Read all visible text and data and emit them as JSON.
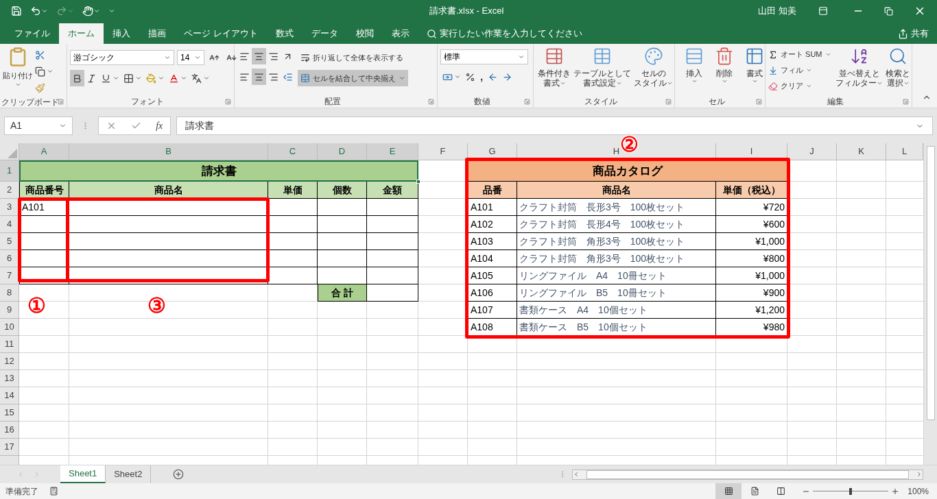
{
  "title_bar": {
    "title": "請求書.xlsx  -  Excel",
    "user": "山田 知美"
  },
  "ribbon_tabs": [
    {
      "label": "ファイル",
      "selected": false
    },
    {
      "label": "ホーム",
      "selected": true
    },
    {
      "label": "挿入",
      "selected": false
    },
    {
      "label": "描画",
      "selected": false
    },
    {
      "label": "ページ レイアウト",
      "selected": false
    },
    {
      "label": "数式",
      "selected": false
    },
    {
      "label": "データ",
      "selected": false
    },
    {
      "label": "校閲",
      "selected": false
    },
    {
      "label": "表示",
      "selected": false
    }
  ],
  "tell_me": "実行したい作業を入力してください",
  "share": "共有",
  "ribbon": {
    "clipboard": {
      "label": "クリップボード",
      "paste": "貼り付け"
    },
    "font": {
      "label": "フォント",
      "font_name": "游ゴシック",
      "font_size": "14",
      "bold": true
    },
    "alignment": {
      "label": "配置",
      "middle_align": true,
      "center_align": true,
      "wrap": "折り返して全体を表示する",
      "merge": "セルを結合して中央揃え",
      "merge_on": true
    },
    "number": {
      "label": "数値",
      "format": "標準",
      "comma": ","
    },
    "styles": {
      "label": "スタイル",
      "buttons": [
        {
          "lines": [
            "条件付き",
            "書式"
          ]
        },
        {
          "lines": [
            "テーブルとして",
            "書式設定"
          ]
        },
        {
          "lines": [
            "セルの",
            "スタイル"
          ]
        }
      ]
    },
    "cells": {
      "label": "セル",
      "buttons": [
        {
          "label": "挿入"
        },
        {
          "label": "削除"
        },
        {
          "label": "書式"
        }
      ]
    },
    "editing": {
      "label": "編集",
      "small": [
        {
          "label": "オート SUM"
        },
        {
          "label": "フィル"
        },
        {
          "label": "クリア"
        }
      ],
      "big": [
        {
          "lines": [
            "並べ替えと",
            "フィルター"
          ]
        },
        {
          "lines": [
            "検索と",
            "選択"
          ]
        }
      ]
    }
  },
  "formula_bar": {
    "name_box": "A1",
    "function_button": "fx",
    "formula": "請求書"
  },
  "columns": [
    "A",
    "B",
    "C",
    "D",
    "E",
    "F",
    "G",
    "H",
    "I",
    "J",
    "K",
    "L"
  ],
  "rows": [
    "1",
    "2",
    "3",
    "4",
    "5",
    "6",
    "7",
    "8",
    "9",
    "10",
    "11",
    "12",
    "13",
    "14",
    "15",
    "16",
    "17"
  ],
  "invoice": {
    "title": "請求書",
    "headers": [
      "商品番号",
      "商品名",
      "単価",
      "個数",
      "金額"
    ],
    "entries": [
      {
        "code": "A101"
      }
    ],
    "total_label": "合 計"
  },
  "catalog": {
    "title": "商品カタログ",
    "headers": [
      "品番",
      "商品名",
      "単価（税込）"
    ],
    "rows": [
      {
        "code": "A101",
        "name": "クラフト封筒　長形3号　100枚セット",
        "price": "¥720"
      },
      {
        "code": "A102",
        "name": "クラフト封筒　長形4号　100枚セット",
        "price": "¥600"
      },
      {
        "code": "A103",
        "name": "クラフト封筒　角形3号　100枚セット",
        "price": "¥1,000"
      },
      {
        "code": "A104",
        "name": "クラフト封筒　角形3号　100枚セット",
        "price": "¥800"
      },
      {
        "code": "A105",
        "name": "リングファイル　A4　10冊セット",
        "price": "¥1,000"
      },
      {
        "code": "A106",
        "name": "リングファイル　B5　10冊セット",
        "price": "¥900"
      },
      {
        "code": "A107",
        "name": "書類ケース　A4　10個セット",
        "price": "¥1,200"
      },
      {
        "code": "A108",
        "name": "書類ケース　B5　10個セット",
        "price": "¥980"
      }
    ]
  },
  "callouts": [
    {
      "label": "①"
    },
    {
      "label": "②"
    },
    {
      "label": "③"
    }
  ],
  "sheet_tabs": [
    {
      "label": "Sheet1",
      "selected": true
    },
    {
      "label": "Sheet2",
      "selected": false
    }
  ],
  "status_bar": {
    "text": "準備完了",
    "views": [
      {
        "selected": true
      },
      {
        "selected": false
      },
      {
        "selected": false
      }
    ],
    "zoom": {
      "level": 0.5
    },
    "zoom_text": "100%"
  }
}
